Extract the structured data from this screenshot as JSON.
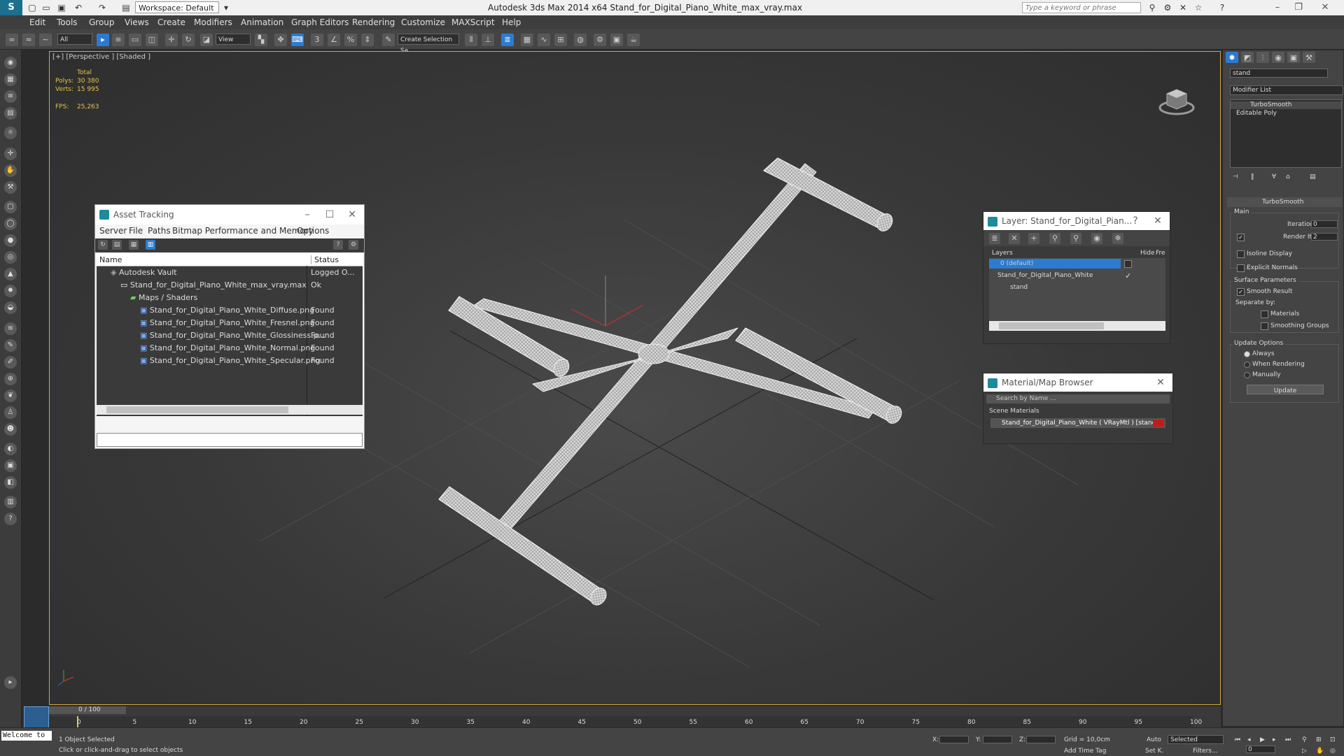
{
  "app": {
    "title": "Autodesk 3ds Max  2014 x64     Stand_for_Digital_Piano_White_max_vray.max",
    "workspace": "Workspace: Default",
    "search_placeholder": "Type a keyword or phrase"
  },
  "menu": [
    "Edit",
    "Tools",
    "Group",
    "Views",
    "Create",
    "Modifiers",
    "Animation",
    "Graph Editors",
    "Rendering",
    "Customize",
    "MAXScript",
    "Help"
  ],
  "toolbar": {
    "filter": "All",
    "ref_coord": "View",
    "selection_set": "Create Selection Se"
  },
  "viewport": {
    "label": "[+] [Perspective ] [Shaded ]",
    "stats": {
      "total_label": "Total",
      "polys_label": "Polys:",
      "polys_value": "30 380",
      "verts_label": "Verts:",
      "verts_value": "15 995",
      "fps_label": "FPS:",
      "fps_value": "25,263"
    }
  },
  "asset_tracking": {
    "title": "Asset Tracking",
    "menu": [
      "Server",
      "File",
      "Paths",
      "Bitmap Performance and Memory",
      "Options"
    ],
    "col_name": "Name",
    "col_status": "Status",
    "rows": [
      {
        "name": "Autodesk Vault",
        "status": "Logged O..."
      },
      {
        "name": "Stand_for_Digital_Piano_White_max_vray.max",
        "status": "Ok"
      },
      {
        "name": "Maps / Shaders",
        "status": ""
      },
      {
        "name": "Stand_for_Digital_Piano_White_Diffuse.png",
        "status": "Found"
      },
      {
        "name": "Stand_for_Digital_Piano_White_Fresnel.png",
        "status": "Found"
      },
      {
        "name": "Stand_for_Digital_Piano_White_Glossiness.p...",
        "status": "Found"
      },
      {
        "name": "Stand_for_Digital_Piano_White_Normal.png",
        "status": "Found"
      },
      {
        "name": "Stand_for_Digital_Piano_White_Specular.png",
        "status": "Found"
      }
    ]
  },
  "layer_window": {
    "title": "Layer: Stand_for_Digital_Pian...",
    "help": "?",
    "col_layers": "Layers",
    "col_hide": "Hide",
    "col_freeze": "Fre",
    "rows": [
      "0 (default)",
      "Stand_for_Digital_Piano_White",
      "stand"
    ]
  },
  "material_browser": {
    "title": "Material/Map Browser",
    "search_placeholder": "Search by Name ...",
    "section": "Scene Materials",
    "item": "Stand_for_Digital_Piano_White  ( VRayMtl ) [stand]"
  },
  "command_panel": {
    "object_name": "stand",
    "modifier_list": "Modifier List",
    "stack": [
      "TurboSmooth",
      "Editable Poly"
    ],
    "rollout_title": "TurboSmooth",
    "main_label": "Main",
    "iterations_label": "Iterations:",
    "iterations_value": "0",
    "render_iters_label": "Render Iters:",
    "render_iters_value": "2",
    "isoline": "Isoline Display",
    "explicit_normals": "Explicit Normals",
    "surface_params": "Surface Parameters",
    "smooth_result": "Smooth Result",
    "separate_by": "Separate by:",
    "materials": "Materials",
    "smoothing_groups": "Smoothing Groups",
    "update_options": "Update Options",
    "always": "Always",
    "when_rendering": "When Rendering",
    "manually": "Manually",
    "update_button": "Update"
  },
  "timeline": {
    "frame": "0 / 100",
    "ticks": [
      "0",
      "5",
      "10",
      "15",
      "20",
      "25",
      "30",
      "35",
      "40",
      "45",
      "50",
      "55",
      "60",
      "65",
      "70",
      "75",
      "80",
      "85",
      "90",
      "95",
      "100"
    ]
  },
  "status": {
    "maxscript": "Welcome to",
    "selected": "1 Object Selected",
    "prompt": "Click or click-and-drag to select objects",
    "x_label": "X:",
    "y_label": "Y:",
    "z_label": "Z:",
    "grid": "Grid = 10,0cm",
    "add_time_tag": "Add Time Tag",
    "auto": "Auto",
    "set_key": "Set K.",
    "selected_dropdown": "Selected",
    "filters": "Filters...",
    "frame_field": "0"
  },
  "colors": {
    "accent": "#2c7bd1",
    "viewport_border": "#d5a840",
    "stats_text": "#e6c34a",
    "material_swatch": "#c41a1a"
  }
}
